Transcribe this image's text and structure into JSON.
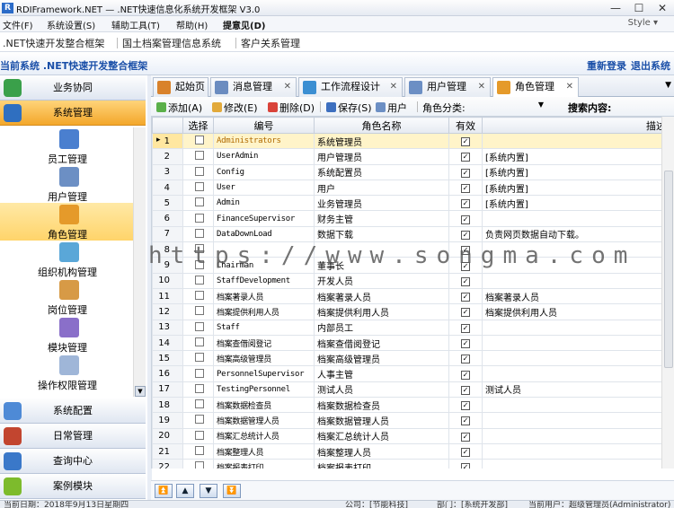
{
  "window": {
    "title": "RDIFramework.NET — .NET快速信息化系统开发框架 V3.0",
    "logo": "R",
    "min": "—",
    "max": "☐",
    "close": "✕"
  },
  "menu": {
    "items": [
      "文件(F)",
      "系统设置(S)",
      "辅助工具(T)",
      "帮助(H)",
      "提意见(D)"
    ],
    "style": "Style ▾"
  },
  "quicktabs": [
    ".NET快速开发整合框架",
    "国土档案管理信息系统",
    "客户关系管理"
  ],
  "sysbar": {
    "current": "当前系统 .NET快速开发整合框架",
    "relogin": "重新登录",
    "logout": "退出系统"
  },
  "sidebar": {
    "top_groups": [
      {
        "label": "业务协同",
        "color": "#3aa04a"
      },
      {
        "label": "系统管理",
        "color": "#2f6fc0"
      }
    ],
    "nav": [
      {
        "label": "员工管理",
        "color": "#4a7fcf"
      },
      {
        "label": "用户管理",
        "color": "#6c8fc4"
      },
      {
        "label": "角色管理",
        "color": "#e59a2a"
      },
      {
        "label": "组织机构管理",
        "color": "#5aa7d8"
      },
      {
        "label": "岗位管理",
        "color": "#d79a46"
      },
      {
        "label": "模块管理",
        "color": "#8a6fc9"
      },
      {
        "label": "操作权限管理",
        "color": "#9fb6d8"
      }
    ],
    "bottom_groups": [
      {
        "label": "系统配置",
        "color": "#4e8ad6"
      },
      {
        "label": "日常管理",
        "color": "#c2452f"
      },
      {
        "label": "查询中心",
        "color": "#3a78c9"
      },
      {
        "label": "案例模块",
        "color": "#7dbb2c"
      }
    ]
  },
  "tabs": [
    {
      "label": "起始页",
      "color": "#d9822b",
      "closable": false
    },
    {
      "label": "消息管理",
      "color": "#6b8cc0",
      "closable": true
    },
    {
      "label": "工作流程设计",
      "color": "#3c8fd2",
      "closable": true
    },
    {
      "label": "用户管理",
      "color": "#6c8fc4",
      "closable": true
    },
    {
      "label": "角色管理",
      "color": "#e59a2a",
      "closable": true
    }
  ],
  "toolbar": {
    "add": "添加(A)",
    "edit": "修改(E)",
    "delete": "删除(D)",
    "save": "保存(S)",
    "user": "用户",
    "category_label": "角色分类:",
    "category_value": "",
    "search_label": "搜索内容:"
  },
  "grid": {
    "columns": [
      "选择",
      "编号",
      "角色名称",
      "有效",
      "描述"
    ],
    "rows": [
      {
        "no": "1",
        "code": "Administrators",
        "name": "系统管理员",
        "valid": true,
        "desc": ""
      },
      {
        "no": "2",
        "code": "UserAdmin",
        "name": "用户管理员",
        "valid": true,
        "desc": "[系统内置]"
      },
      {
        "no": "3",
        "code": "Config",
        "name": "系统配置员",
        "valid": true,
        "desc": "[系统内置]"
      },
      {
        "no": "4",
        "code": "User",
        "name": "用户",
        "valid": true,
        "desc": "[系统内置]"
      },
      {
        "no": "5",
        "code": "Admin",
        "name": "业务管理员",
        "valid": true,
        "desc": "[系统内置]"
      },
      {
        "no": "6",
        "code": "FinanceSupervisor",
        "name": "财务主管",
        "valid": true,
        "desc": ""
      },
      {
        "no": "7",
        "code": "DataDownLoad",
        "name": "数据下载",
        "valid": true,
        "desc": "负责网页数据自动下载。"
      },
      {
        "no": "8",
        "code": "",
        "name": "",
        "valid": true,
        "desc": ""
      },
      {
        "no": "9",
        "code": "Chairman",
        "name": "董事长",
        "valid": true,
        "desc": ""
      },
      {
        "no": "10",
        "code": "StaffDevelopment",
        "name": "开发人员",
        "valid": true,
        "desc": ""
      },
      {
        "no": "11",
        "code": "档案著录人员",
        "name": "档案著录人员",
        "valid": true,
        "desc": "档案著录人员"
      },
      {
        "no": "12",
        "code": "档案提供利用人员",
        "name": "档案提供利用人员",
        "valid": true,
        "desc": "档案提供利用人员"
      },
      {
        "no": "13",
        "code": "Staff",
        "name": "内部员工",
        "valid": true,
        "desc": ""
      },
      {
        "no": "14",
        "code": "档案查借阅登记",
        "name": "档案查借阅登记",
        "valid": true,
        "desc": ""
      },
      {
        "no": "15",
        "code": "档案高级管理员",
        "name": "档案高级管理员",
        "valid": true,
        "desc": ""
      },
      {
        "no": "16",
        "code": "PersonnelSupervisor",
        "name": "人事主管",
        "valid": true,
        "desc": ""
      },
      {
        "no": "17",
        "code": "TestingPersonnel",
        "name": "测试人员",
        "valid": true,
        "desc": "测试人员"
      },
      {
        "no": "18",
        "code": "档案数据检查员",
        "name": "档案数据检查员",
        "valid": true,
        "desc": ""
      },
      {
        "no": "19",
        "code": "档案数据管理人员",
        "name": "档案数据管理人员",
        "valid": true,
        "desc": ""
      },
      {
        "no": "20",
        "code": "档案汇总统计人员",
        "name": "档案汇总统计人员",
        "valid": true,
        "desc": ""
      },
      {
        "no": "21",
        "code": "档案整理人员",
        "name": "档案整理人员",
        "valid": true,
        "desc": ""
      },
      {
        "no": "22",
        "code": "档案报表打印",
        "name": "档案报表打印",
        "valid": true,
        "desc": ""
      }
    ]
  },
  "watermark": "https://www.songma.com",
  "pager": [
    "⏫",
    "▲",
    "▼",
    "⏬"
  ],
  "status": {
    "date": "当前日期：2018年9月13日星期四",
    "company": "公司：[节能科技]",
    "dept": "部门：[系统开发部]",
    "user": "当前用户：超级管理员(Administrator)"
  }
}
